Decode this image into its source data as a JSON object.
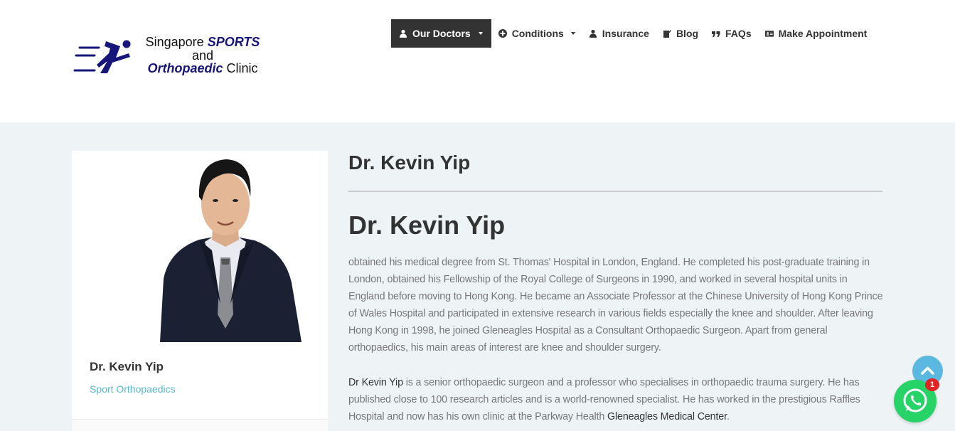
{
  "logo": {
    "line1_plain": "Singapore ",
    "line1_brand": "SPORTS",
    "line2": "and",
    "line3_brand": "Orthopaedic",
    "line3_plain": " Clinic"
  },
  "nav": {
    "items": [
      {
        "label": "Our Doctors",
        "icon": "user-icon",
        "dropdown": true,
        "active": true
      },
      {
        "label": "Conditions",
        "icon": "plus-circle-icon",
        "dropdown": true
      },
      {
        "label": "Insurance",
        "icon": "user-icon"
      },
      {
        "label": "Blog",
        "icon": "edit-icon"
      },
      {
        "label": "FAQs",
        "icon": "quote-icon"
      },
      {
        "label": "Make Appointment",
        "icon": "id-card-icon"
      }
    ]
  },
  "card": {
    "name": "Dr. Kevin Yip",
    "specialty": "Sport Orthopaedics"
  },
  "main": {
    "title_small": "Dr. Kevin Yip",
    "title_large": "Dr. Kevin Yip",
    "para1": "obtained his medical degree from St. Thomas' Hospital in London, England. He completed his post-graduate training in London, obtained his Fellowship of the Royal College of Surgeons in 1990, and worked in several hospital units in England before moving to Hong Kong. He became an Associate Professor at the Chinese University of Hong Kong Prince of Wales Hospital and participated in extensive research in various fields especially the knee and shoulder. After leaving Hong Kong in 1998, he joined Gleneagles Hospital as a Consultant Orthopaedic Surgeon. Apart from general orthopaedics, his main areas of interest are knee and shoulder surgery.",
    "para2_name": "Dr Kevin Yip",
    "para2_body": " is a senior orthopaedic surgeon and a professor who specialises in orthopaedic trauma surgery. He has published close to 100 research articles and is a world-renowned specialist. He has worked in the prestigious Raffles Hospital and now has his own clinic at the Parkway Health ",
    "para2_link": "Gleneagles Medical Center",
    "para2_end": "."
  },
  "floating": {
    "whatsapp_badge": "1"
  },
  "colors": {
    "brand_navy": "#15157a",
    "nav_active_bg": "#333333",
    "specialty": "#5bb8d0",
    "content_bg": "#eef3f6",
    "whatsapp": "#25d366",
    "to_top": "#5bb8e0"
  }
}
